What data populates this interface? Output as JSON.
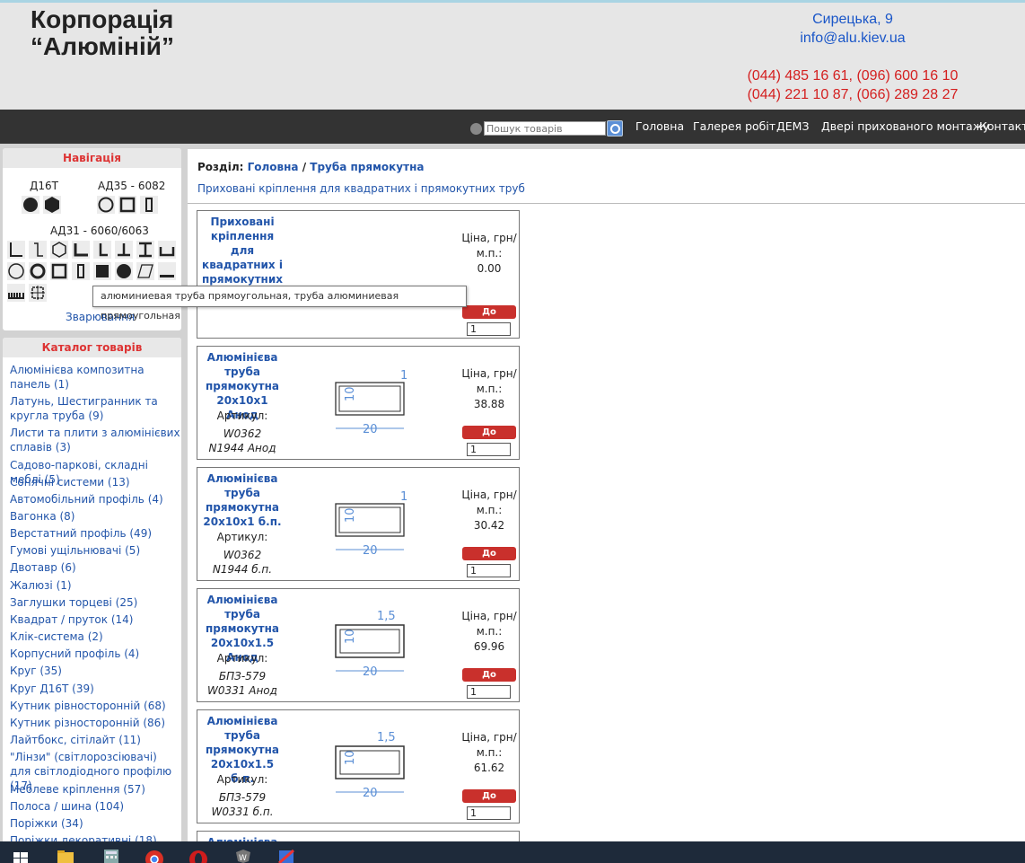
{
  "header": {
    "logo_line1": "Корпорація",
    "logo_line2": "“Алюміній”",
    "address": "Сирецька, 9",
    "email": "info@alu.kiev.ua",
    "phone_line1": "(044) 485 16 61, (096) 600 16 10",
    "phone_line2": "(044) 221 10 87, (066) 289 28 27"
  },
  "topnav": {
    "search_placeholder": "Пошук товарів",
    "links": [
      "Головна",
      "Галерея робіт",
      "ДЕМЗ",
      "Двері прихованого монтажу",
      "Контакти"
    ]
  },
  "navigation": {
    "title": "Навігація",
    "group1_label": "Д16Т",
    "group2_label": "АД35 - 6082",
    "group3_label": "АД31 - 6060/6063",
    "welding": "Зварювання"
  },
  "catalog": {
    "title": "Каталог товарів",
    "items": [
      "Алюмінієва композитна панель (1)",
      "Латунь, Шестигранник та кругла труба (9)",
      "Листи та плити з алюмінієвих сплавів (3)",
      "Садово-паркові, складні меблі (5)",
      "Сонячні системи (13)",
      "Автомобільний профіль (4)",
      "Вагонка (8)",
      "Верстатний профіль (49)",
      "Гумові ущільнювачі (5)",
      "Двотавр (6)",
      "Жалюзі (1)",
      "Заглушки торцеві (25)",
      "Квадрат / пруток (14)",
      "Клік-система (2)",
      "Корпусний профіль (4)",
      "Круг (35)",
      "Круг Д16Т (39)",
      "Кутник рівносторонній (68)",
      "Кутник різносторонній (86)",
      "Лайтбокс, сітілайт (11)",
      "\"Лінзи\" (світлорозсіювачі) для світлодіодного профілю (17)",
      "Меблеве кріплення (57)",
      "Полоса / шина (104)",
      "Поріжки (34)",
      "Поріжки декоративні (18)"
    ]
  },
  "breadcrumb": {
    "prefix": "Розділ:",
    "home": "Головна",
    "sep": "/",
    "current": "Труба прямокутна"
  },
  "subcategory_link": "Приховані кріплення для квадратних і прямокутних труб",
  "tooltip": "алюминиевая труба прямоугольная, труба алюминиевая прямоугольная",
  "products": [
    {
      "name": "Приховані кріплення для квадратних і прямокутних труб",
      "article_label": "",
      "article1": "",
      "article2": "",
      "price_label": "Ціна, грн/ м.п.:",
      "price": "0.00",
      "cart": "До кошика",
      "qty": "1",
      "dim_top": "",
      "dim_side": "",
      "dim_bottom": ""
    },
    {
      "name": "Алюмінієва труба прямокутна 20x10x1 Анод",
      "article_label": "Артикул:",
      "article1": "W0362",
      "article2": "N1944 Анод",
      "price_label": "Ціна, грн/ м.п.:",
      "price": "38.88",
      "cart": "До кошика",
      "qty": "1",
      "dim_top": "1",
      "dim_side": "10",
      "dim_bottom": "20"
    },
    {
      "name": "Алюмінієва труба прямокутна 20x10x1 б.п.",
      "article_label": "Артикул:",
      "article1": "W0362",
      "article2": "N1944 б.п.",
      "price_label": "Ціна, грн/ м.п.:",
      "price": "30.42",
      "cart": "До кошика",
      "qty": "1",
      "dim_top": "1",
      "dim_side": "10",
      "dim_bottom": "20"
    },
    {
      "name": "Алюмінієва труба прямокутна 20x10x1.5 Анод",
      "article_label": "Артикул:",
      "article1": "БПЗ-579",
      "article2": "W0331 Анод",
      "price_label": "Ціна, грн/ м.п.:",
      "price": "69.96",
      "cart": "До кошика",
      "qty": "1",
      "dim_top": "1,5",
      "dim_side": "10",
      "dim_bottom": "20"
    },
    {
      "name": "Алюмінієва труба прямокутна 20x10x1.5 б.п.",
      "article_label": "Артикул:",
      "article1": "БПЗ-579",
      "article2": "W0331 б.п.",
      "price_label": "Ціна, грн/ м.п.:",
      "price": "61.62",
      "cart": "До кошика",
      "qty": "1",
      "dim_top": "1,5",
      "dim_side": "10",
      "dim_bottom": "20"
    },
    {
      "name": "Алюмінієва",
      "article_label": "",
      "article1": "",
      "article2": "",
      "price_label": "",
      "price": "",
      "cart": "",
      "qty": "",
      "dim_top": "",
      "dim_side": "",
      "dim_bottom": ""
    }
  ],
  "taskbar_icons": [
    "windows-start-icon",
    "file-explorer-icon",
    "calculator-icon",
    "chrome-icon",
    "opera-icon",
    "game-icon",
    "app-icon"
  ]
}
